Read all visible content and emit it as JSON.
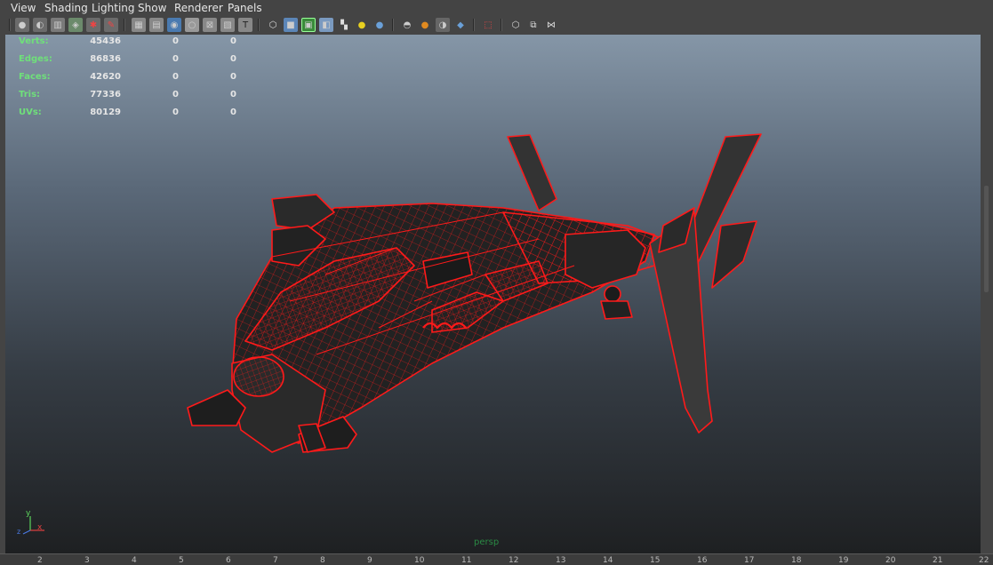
{
  "menu": [
    "View",
    "Shading",
    "Lighting",
    "Show",
    "Renderer",
    "Panels"
  ],
  "toolbar_icons": [
    "select-camera-icon",
    "camera-attributes-icon",
    "bookmark-icon",
    "image-plane-icon",
    "isolate-icon",
    "paint-icon",
    "grid-icon",
    "film-gate-icon",
    "resolution-gate-icon",
    "gate-mask-icon",
    "field-chart-icon",
    "safe-action-icon",
    "safe-title-icon",
    "wireframe-icon",
    "smooth-shade-icon",
    "wireframe-on-shaded-icon",
    "default-material-icon",
    "texture-icon",
    "use-lights-icon",
    "shadows-icon",
    "ambient-occlusion-icon",
    "motion-blur-icon",
    "antialiasing-icon",
    "depth-of-field-icon",
    "isolate-select-icon",
    "xray-icon",
    "xray-joints-icon",
    "xray-components-icon"
  ],
  "hud": {
    "rows": [
      {
        "label": "Verts:",
        "a": "45436",
        "b": "0",
        "c": "0"
      },
      {
        "label": "Edges:",
        "a": "86836",
        "b": "0",
        "c": "0"
      },
      {
        "label": "Faces:",
        "a": "42620",
        "b": "0",
        "c": "0"
      },
      {
        "label": "Tris:",
        "a": "77336",
        "b": "0",
        "c": "0"
      },
      {
        "label": "UVs:",
        "a": "80129",
        "b": "0",
        "c": "0"
      }
    ]
  },
  "camera_label": "persp",
  "axis": {
    "y": "y",
    "x": "x",
    "z": "z"
  },
  "timeline": [
    "2",
    "3",
    "4",
    "5",
    "6",
    "7",
    "8",
    "9",
    "10",
    "11",
    "12",
    "13",
    "14",
    "15",
    "16",
    "17",
    "18",
    "19",
    "20",
    "21",
    "22"
  ],
  "colors": {
    "wireframe": "#ff1a1a",
    "hud_label": "#6fe07a",
    "camera_label": "#2a8a44"
  }
}
